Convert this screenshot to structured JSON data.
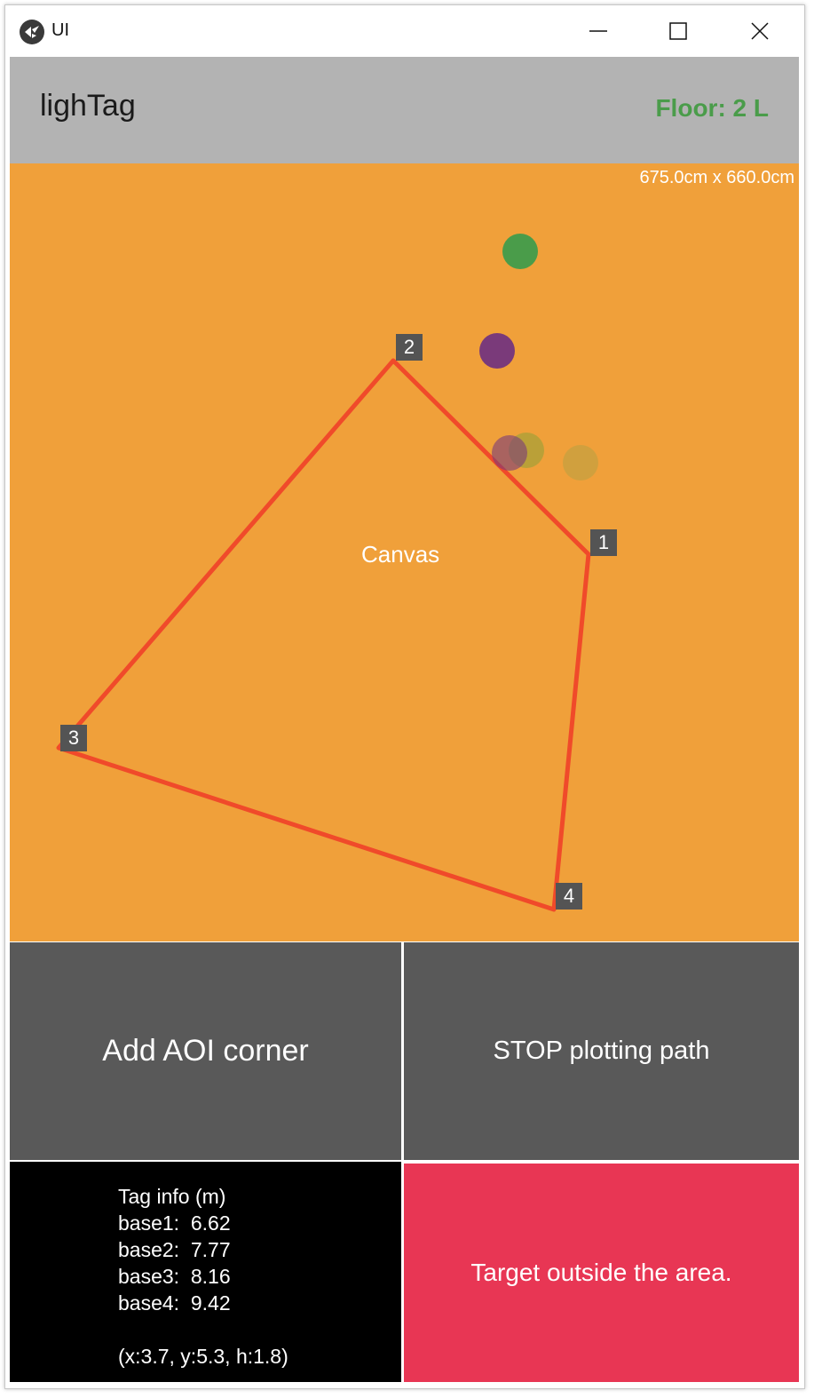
{
  "window": {
    "title": "UI"
  },
  "header": {
    "app_name": "lighTag",
    "floor": "Floor: 2 L",
    "floor_color": "#4a9c4a"
  },
  "canvas": {
    "label": "Canvas",
    "dimensions": "675.0cm x 660.0cm",
    "background": "#f0a03a",
    "aoi_line_color": "#f04a2a",
    "corners": [
      {
        "label": "1"
      },
      {
        "label": "2"
      },
      {
        "label": "3"
      },
      {
        "label": "4"
      }
    ],
    "markers": [
      {
        "name": "green",
        "color": "#4a9c4a"
      },
      {
        "name": "purple",
        "color": "#7a3a7a"
      },
      {
        "name": "purple-faded",
        "color": "#8a4a6a"
      },
      {
        "name": "olive-faded",
        "color": "#b0a040"
      },
      {
        "name": "yellow-faded",
        "color": "#d8a040"
      }
    ]
  },
  "buttons": {
    "add_aoi": "Add AOI corner",
    "stop_path": "STOP plotting path"
  },
  "tag_info": {
    "title": "Tag info (m)",
    "bases": [
      {
        "label": "base1:",
        "value": "6.62"
      },
      {
        "label": "base2:",
        "value": "7.77"
      },
      {
        "label": "base3:",
        "value": "8.16"
      },
      {
        "label": "base4:",
        "value": "9.42"
      }
    ],
    "position": "(x:3.7, y:5.3, h:1.8)"
  },
  "status": {
    "message": "Target outside the area.",
    "color": "#e83654"
  }
}
